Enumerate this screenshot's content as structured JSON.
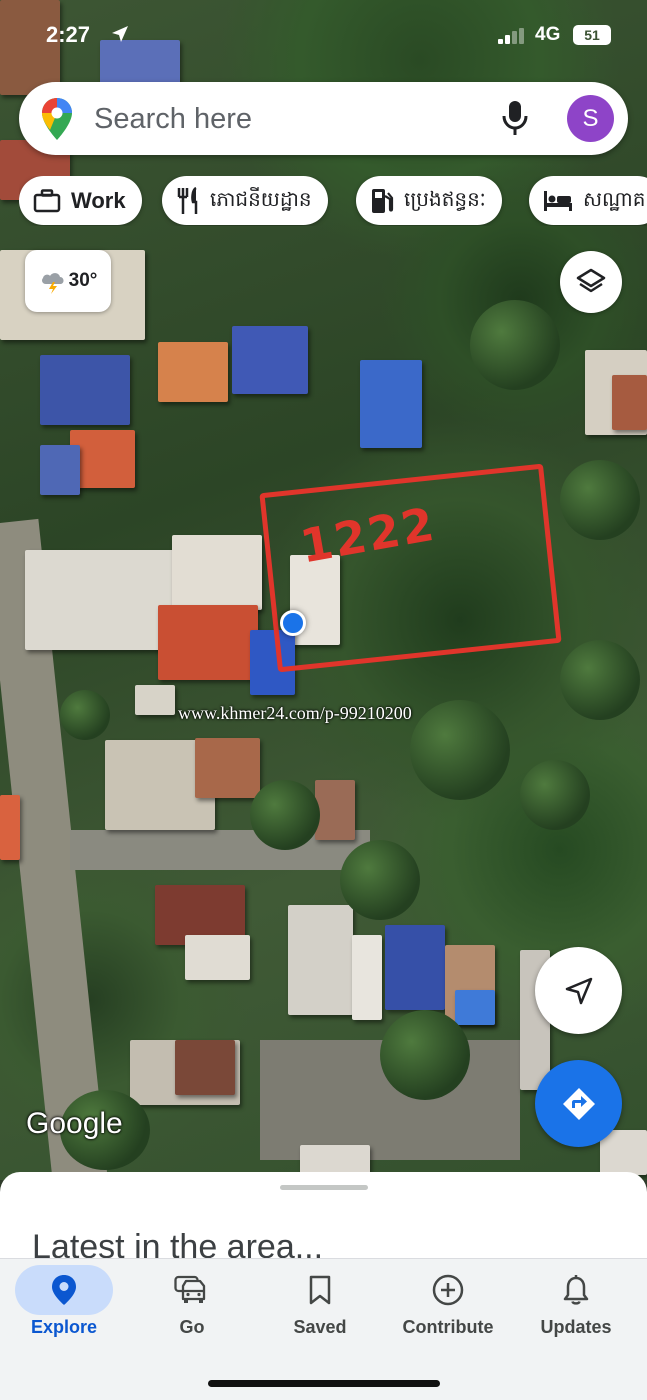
{
  "status_bar": {
    "time": "2:27",
    "network": "4G",
    "battery": "51"
  },
  "search": {
    "placeholder": "Search here",
    "avatar_letter": "S"
  },
  "chips": [
    {
      "label": "Work",
      "icon": "briefcase-icon"
    },
    {
      "label": "ភោជនីយដ្ឋាន",
      "icon": "restaurant-icon"
    },
    {
      "label": "ប្រេងឥន្ធនៈ",
      "icon": "gas-station-icon"
    },
    {
      "label": "សណ្ឋាគ",
      "icon": "hotel-icon"
    }
  ],
  "weather": {
    "temp": "30°",
    "icon": "thunderstorm-icon"
  },
  "map": {
    "parcel_label": "1222",
    "watermark": "www.khmer24.com/p-99210200",
    "attribution": "Google",
    "parcel_color": "#e0352b"
  },
  "sheet": {
    "title": "Latest in the area..."
  },
  "bottom_nav": [
    {
      "label": "Explore",
      "icon": "pin-icon",
      "active": true
    },
    {
      "label": "Go",
      "icon": "car-icon",
      "active": false
    },
    {
      "label": "Saved",
      "icon": "bookmark-icon",
      "active": false
    },
    {
      "label": "Contribute",
      "icon": "plus-circle-icon",
      "active": false
    },
    {
      "label": "Updates",
      "icon": "bell-icon",
      "active": false
    }
  ],
  "colors": {
    "accent": "#1a73e8",
    "active_pill": "#c9dcfb",
    "active_text": "#0b57d0"
  }
}
